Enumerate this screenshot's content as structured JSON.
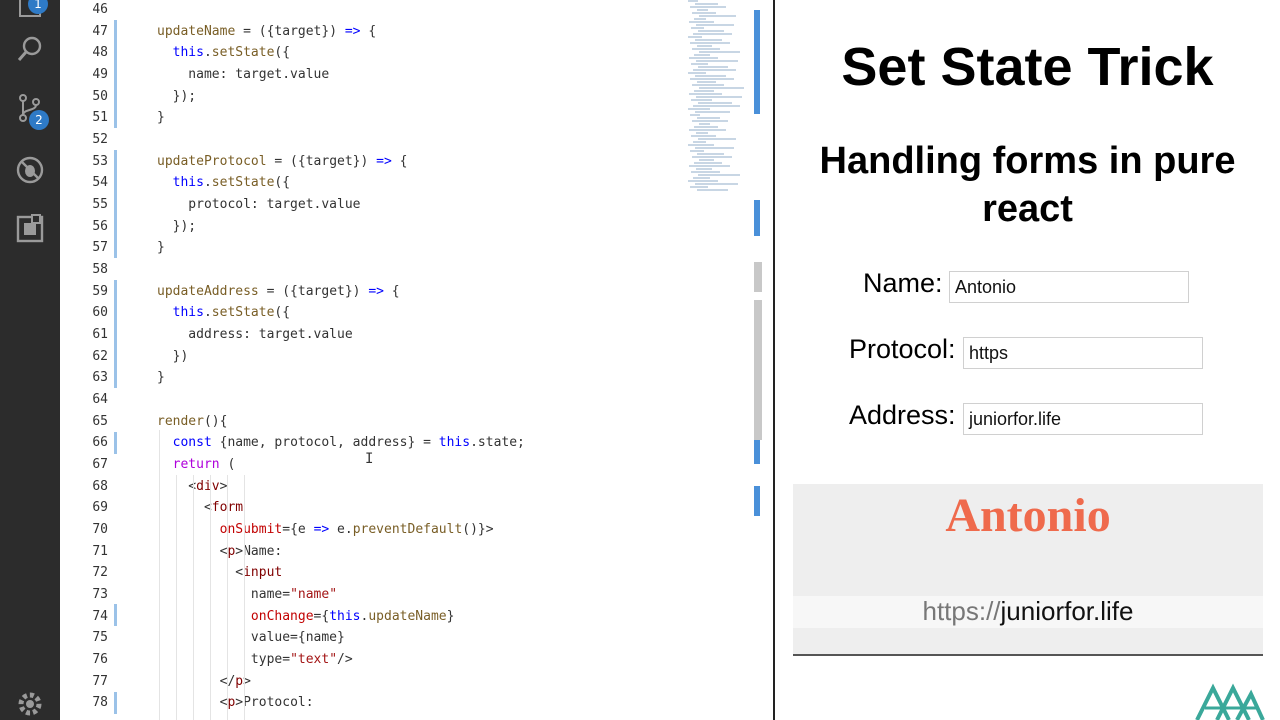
{
  "activity_bar": {
    "top_badge": "1",
    "source_control_badge": "2",
    "icons": [
      "files-icon",
      "search-icon",
      "source-control-icon",
      "debug-icon",
      "extensions-icon",
      "settings-icon"
    ]
  },
  "editor": {
    "lines": [
      {
        "n": "46",
        "t": ""
      },
      {
        "n": "47",
        "t": "updateName = ({target}) => {"
      },
      {
        "n": "48",
        "t": "  this.setState({"
      },
      {
        "n": "49",
        "t": "    name: target.value"
      },
      {
        "n": "50",
        "t": "  });"
      },
      {
        "n": "51",
        "t": "}"
      },
      {
        "n": "52",
        "t": ""
      },
      {
        "n": "53",
        "t": "updateProtocol = ({target}) => {"
      },
      {
        "n": "54",
        "t": "  this.setState({"
      },
      {
        "n": "55",
        "t": "    protocol: target.value"
      },
      {
        "n": "56",
        "t": "  });"
      },
      {
        "n": "57",
        "t": "}"
      },
      {
        "n": "58",
        "t": ""
      },
      {
        "n": "59",
        "t": "updateAddress = ({target}) => {"
      },
      {
        "n": "60",
        "t": "  this.setState({"
      },
      {
        "n": "61",
        "t": "    address: target.value"
      },
      {
        "n": "62",
        "t": "  })"
      },
      {
        "n": "63",
        "t": "}"
      },
      {
        "n": "64",
        "t": ""
      },
      {
        "n": "65",
        "t": "render(){"
      },
      {
        "n": "66",
        "t": "  const {name, protocol, address} = this.state;"
      },
      {
        "n": "67",
        "t": "  return ("
      },
      {
        "n": "68",
        "t": "    <div>"
      },
      {
        "n": "69",
        "t": "      <form"
      },
      {
        "n": "70",
        "t": "        onSubmit={e => e.preventDefault()}>"
      },
      {
        "n": "71",
        "t": "        <p>Name:"
      },
      {
        "n": "72",
        "t": "          <input"
      },
      {
        "n": "73",
        "t": "            name=\"name\""
      },
      {
        "n": "74",
        "t": "            onChange={this.updateName}"
      },
      {
        "n": "75",
        "t": "            value={name}"
      },
      {
        "n": "76",
        "t": "            type=\"text\"/>"
      },
      {
        "n": "77",
        "t": "        </p>"
      },
      {
        "n": "78",
        "t": "        <p>Protocol:"
      }
    ]
  },
  "preview": {
    "title": "Set State Trick",
    "subtitle_line1": "Handling forms in pure",
    "subtitle_line2": "react",
    "fields": [
      {
        "label": "Name:",
        "value": "Antonio"
      },
      {
        "label": "Protocol:",
        "value": "https"
      },
      {
        "label": "Address:",
        "value": "juniorfor.life"
      }
    ],
    "output": {
      "name": "Antonio",
      "protocol": "https://",
      "address": "juniorfor.life"
    }
  },
  "colors": {
    "activity_bg": "#2c2c2c",
    "badge": "#2e7ac6",
    "output_name": "#ef6a4c",
    "keyword": "#0000ff",
    "function": "#795e26",
    "tag": "#800000"
  }
}
